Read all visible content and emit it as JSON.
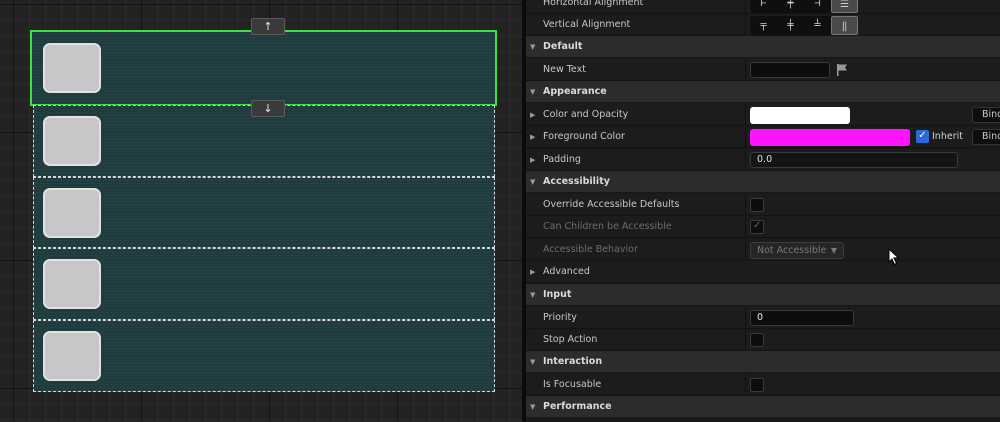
{
  "canvas": {
    "move_up_glyph": "↑",
    "move_down_glyph": "↓",
    "slots": [
      {
        "selected": true
      },
      {
        "selected": false
      },
      {
        "selected": false
      },
      {
        "selected": false
      },
      {
        "selected": false
      }
    ]
  },
  "details": {
    "horizontal_alignment": {
      "label": "Horizontal Alignment",
      "icons": [
        "align-left-icon",
        "align-center-icon",
        "align-right-icon",
        "align-fill-icon"
      ],
      "active_index": 3
    },
    "vertical_alignment": {
      "label": "Vertical Alignment",
      "icons": [
        "align-top-icon",
        "align-middle-icon",
        "align-bottom-icon",
        "align-fill-icon"
      ],
      "active_index": 3
    },
    "default": {
      "category": "Default",
      "new_text": {
        "label": "New Text",
        "value": ""
      }
    },
    "appearance": {
      "category": "Appearance",
      "color_and_opacity": {
        "label": "Color and Opacity",
        "color": "#ffffff",
        "bind_label": "Bind"
      },
      "foreground_color": {
        "label": "Foreground Color",
        "color": "#ff14ff",
        "inherit_label": "Inherit",
        "inherit_checked": true,
        "bind_label": "Bind"
      },
      "padding": {
        "label": "Padding",
        "value": "0.0"
      }
    },
    "accessibility": {
      "category": "Accessibility",
      "override_defaults": {
        "label": "Override Accessible Defaults",
        "checked": false
      },
      "can_children": {
        "label": "Can Children be Accessible",
        "checked": true
      },
      "behavior": {
        "label": "Accessible Behavior",
        "value": "Not Accessible"
      }
    },
    "advanced": {
      "label": "Advanced"
    },
    "input": {
      "category": "Input",
      "priority": {
        "label": "Priority",
        "value": "0"
      },
      "stop_action": {
        "label": "Stop Action",
        "checked": false
      }
    },
    "interaction": {
      "category": "Interaction",
      "is_focusable": {
        "label": "Is Focusable",
        "checked": false
      }
    },
    "performance": {
      "category": "Performance"
    }
  },
  "colors": {
    "selection_outline": "#3fe03f",
    "slot_fill": "#1f3d40",
    "foreground_magenta": "#ff14ff",
    "inherit_blue": "#2a6ad8"
  }
}
